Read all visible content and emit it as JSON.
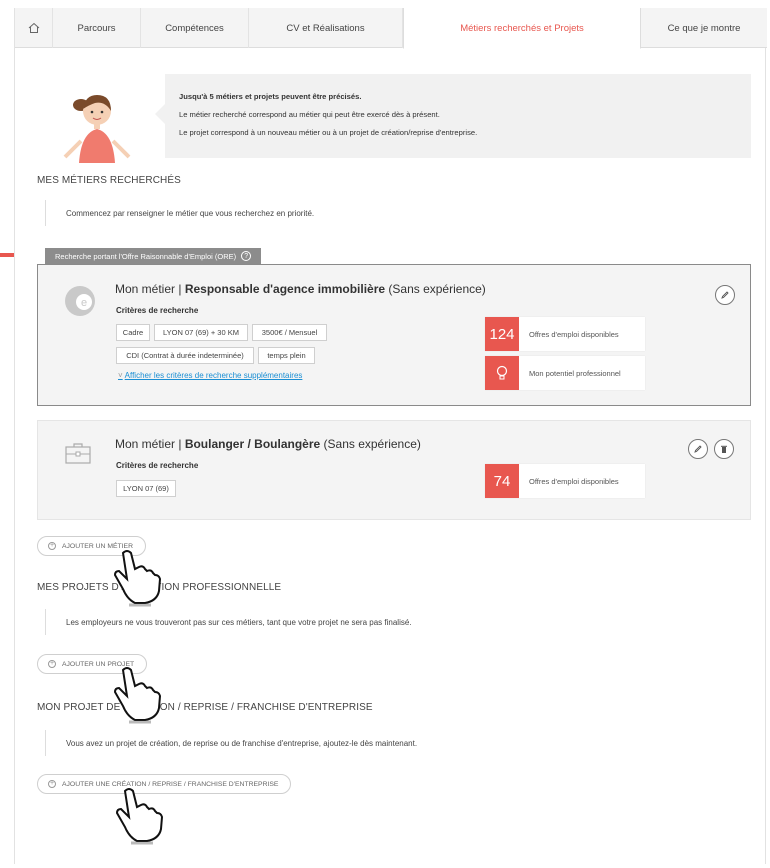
{
  "tabs": [
    {
      "label": "Parcours"
    },
    {
      "label": "Compétences"
    },
    {
      "label": "CV et Réalisations"
    },
    {
      "label": "Métiers recherchés et Projets"
    },
    {
      "label": "Ce que je montre"
    }
  ],
  "info": {
    "line1": "Jusqu'à 5 métiers et projets peuvent être précisés.",
    "line2": "Le métier recherché correspond au métier qui peut être exercé dès à présent.",
    "line3": "Le projet correspond à un nouveau métier ou à un projet de création/reprise d'entreprise."
  },
  "metiers": {
    "title": "MES MÉTIERS RECHERCHÉS",
    "note": "Commencez par renseigner le métier que vous recherchez en priorité.",
    "ore_label": "Recherche portant l'Offre Raisonnable d'Emploi (ORE)",
    "ore_help": "?",
    "card1": {
      "prefix": "Mon métier |",
      "job": "Responsable d'agence immobilière",
      "exp": "(Sans expérience)",
      "criteria_label": "Critères de recherche",
      "chips": [
        "Cadre",
        "LYON 07 (69) + 30 KM",
        "3500€ / Mensuel",
        "CDI (Contrat à durée indeterminée)",
        "temps plein"
      ],
      "more_chevron": "˅",
      "more_link": "Afficher les critères de recherche supplémentaires",
      "offers_count": "124",
      "offers_label": "Offres d'emploi disponibles",
      "potential_label": "Mon potentiel professionnel"
    },
    "card2": {
      "prefix": "Mon métier |",
      "job": "Boulanger / Boulangère",
      "exp": "(Sans expérience)",
      "criteria_label": "Critères de recherche",
      "chips": [
        "LYON 07 (69)"
      ],
      "offers_count": "74",
      "offers_label": "Offres d'emploi disponibles"
    },
    "add_label": "AJOUTER UN MÉTIER"
  },
  "projets": {
    "title": "MES PROJETS D'ÉVOLUTION PROFESSIONNELLE",
    "note": "Les employeurs ne vous trouveront pas sur ces métiers, tant que votre projet ne sera pas finalisé.",
    "add_label": "AJOUTER UN PROJET"
  },
  "creation": {
    "title": "MON PROJET DE CRÉATION / REPRISE / FRANCHISE D'ENTREPRISE",
    "note": "Vous avez un projet de création, de reprise ou de franchise d'entreprise, ajoutez-le dès maintenant.",
    "add_label": "AJOUTER UNE CRÉATION / REPRISE / FRANCHISE D'ENTREPRISE"
  },
  "add_plus": "+",
  "colors": {
    "accent": "#e8574f",
    "link": "#1a8ed3",
    "ore_tab": "#8c8c8c"
  }
}
